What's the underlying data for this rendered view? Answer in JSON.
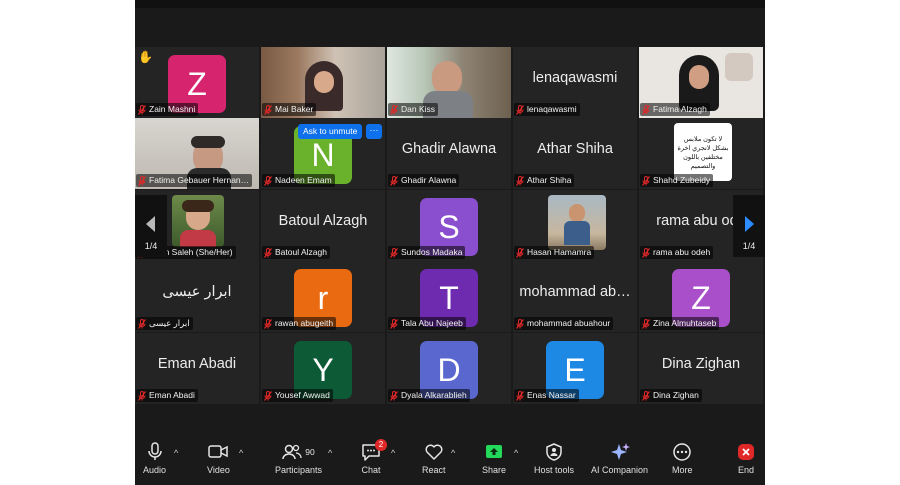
{
  "participants": [
    {
      "id": "p1",
      "label": "Zain Mashni",
      "avatar_letter": "Z",
      "avatar_color": "#d6246e",
      "raised_hand": true
    },
    {
      "id": "p2",
      "label": "Mai Baker",
      "photo": true
    },
    {
      "id": "p3",
      "label": "Dan Kiss",
      "photo": true,
      "active_speaker": true
    },
    {
      "id": "p4",
      "label": "lenaqawasmi",
      "big_name": "lenaqawasmi"
    },
    {
      "id": "p5",
      "label": "Fatima Alzagh",
      "photo": true
    },
    {
      "id": "p6",
      "label": "Fatima Gebauer Hernan…",
      "photo": true
    },
    {
      "id": "p7",
      "label": "Nadeen Emam",
      "avatar_letter": "N",
      "avatar_color": "#6bb22c"
    },
    {
      "id": "p8",
      "label": "Ghadir Alawna",
      "big_name": "Ghadir Alawna"
    },
    {
      "id": "p9",
      "label": "Athar Shiha",
      "big_name": "Athar Shiha"
    },
    {
      "id": "p10",
      "label": "Shahd Zubeidy",
      "photo": true,
      "photo_text": "لا تكون ملابس بشكل لانجري اخرة مختلفين باللون والتصميم"
    },
    {
      "id": "p11",
      "label": "…am Saleh (She/Her)",
      "photo": true
    },
    {
      "id": "p12",
      "label": "Batoul Alzagh",
      "big_name": "Batoul Alzagh"
    },
    {
      "id": "p13",
      "label": "Sundos Madaka",
      "avatar_letter": "S",
      "avatar_color": "#8a4fcf"
    },
    {
      "id": "p14",
      "label": "Hasan Hamamra",
      "photo": true
    },
    {
      "id": "p15",
      "label": "rama abu odeh",
      "big_name": "rama abu ode"
    },
    {
      "id": "p16",
      "label": "ابرار عيسى",
      "big_name": "ابرار عيسى"
    },
    {
      "id": "p17",
      "label": "rawan abugeith",
      "avatar_letter": "r",
      "avatar_color": "#ea6a12"
    },
    {
      "id": "p18",
      "label": "Tala Abu Najeeb",
      "avatar_letter": "T",
      "avatar_color": "#6f2bb0"
    },
    {
      "id": "p19",
      "label": "mohammad abuahour",
      "big_name": "mohammad ab…"
    },
    {
      "id": "p20",
      "label": "Zina Almuhtaseb",
      "avatar_letter": "Z",
      "avatar_color": "#a84fc9"
    },
    {
      "id": "p21",
      "label": "Eman Abadi",
      "big_name": "Eman Abadi"
    },
    {
      "id": "p22",
      "label": "Yousef Awwad",
      "avatar_letter": "Y",
      "avatar_color": "#0c5a36"
    },
    {
      "id": "p23",
      "label": "Dyala Alkarablieh",
      "avatar_letter": "D",
      "avatar_color": "#5a67cf"
    },
    {
      "id": "p24",
      "label": "Enas Nassar",
      "avatar_letter": "E",
      "avatar_color": "#1e88e5"
    },
    {
      "id": "p25",
      "label": "Dina Zighan",
      "big_name": "Dina Zighan"
    }
  ],
  "hover": {
    "ask_to_unmute": "Ask to unmute",
    "more": "···"
  },
  "pagination": {
    "left": "1/4",
    "right": "1/4"
  },
  "toolbar": {
    "audio": "Audio",
    "video": "Video",
    "participants": "Participants",
    "participants_count": "90",
    "chat": "Chat",
    "chat_badge": "2",
    "react": "React",
    "share": "Share",
    "host_tools": "Host tools",
    "ai_companion": "AI Companion",
    "more": "More",
    "end": "End"
  },
  "colors": {
    "accent": "#0e71eb",
    "active_speaker": "#23d959",
    "muted": "#e02828",
    "share": "#23d959",
    "end": "#e02828"
  }
}
